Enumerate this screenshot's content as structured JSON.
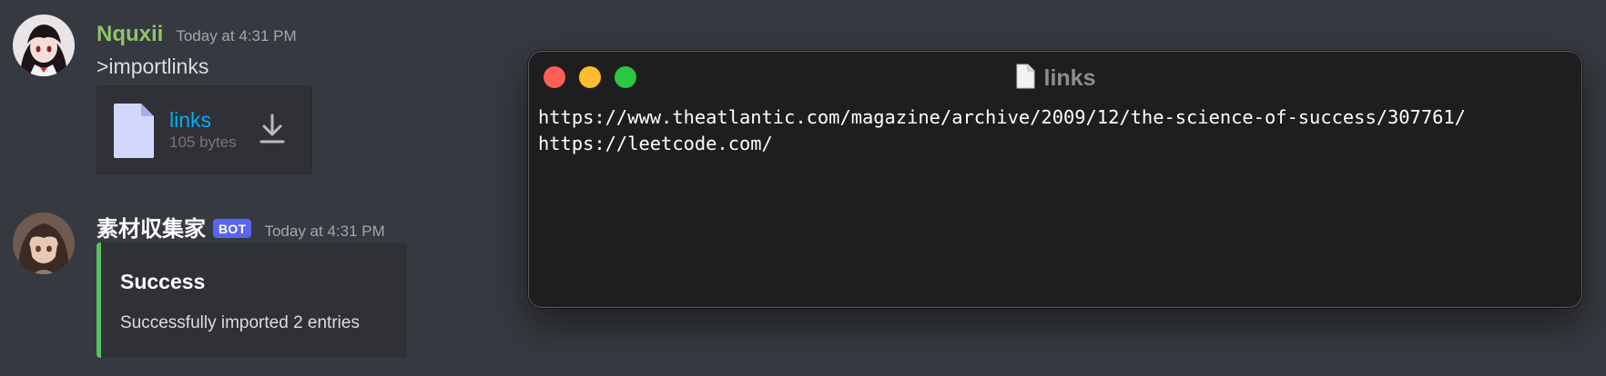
{
  "messages": [
    {
      "username": "Nquxii",
      "username_color": "#8fc46c",
      "timestamp": "Today at 4:31 PM",
      "text": ">importlinks",
      "attachment": {
        "file_name": "links",
        "file_size": "105 bytes",
        "icon": "file-icon",
        "action_icon": "download-icon"
      }
    },
    {
      "username": "素材収集家",
      "username_color": "#ffffff",
      "badge": "BOT",
      "timestamp": "Today at 4:31 PM",
      "embed": {
        "title": "Success",
        "description": "Successfully imported 2 entries",
        "accent_color": "#57c35d"
      }
    }
  ],
  "terminal": {
    "title": "links",
    "title_icon": "document-icon",
    "lines": [
      "https://www.theatlantic.com/magazine/archive/2009/12/the-science-of-success/307761/",
      "https://leetcode.com/"
    ]
  },
  "colors": {
    "background": "#36393f",
    "link": "#00aff4",
    "terminal_bg": "#1e1e1e"
  }
}
